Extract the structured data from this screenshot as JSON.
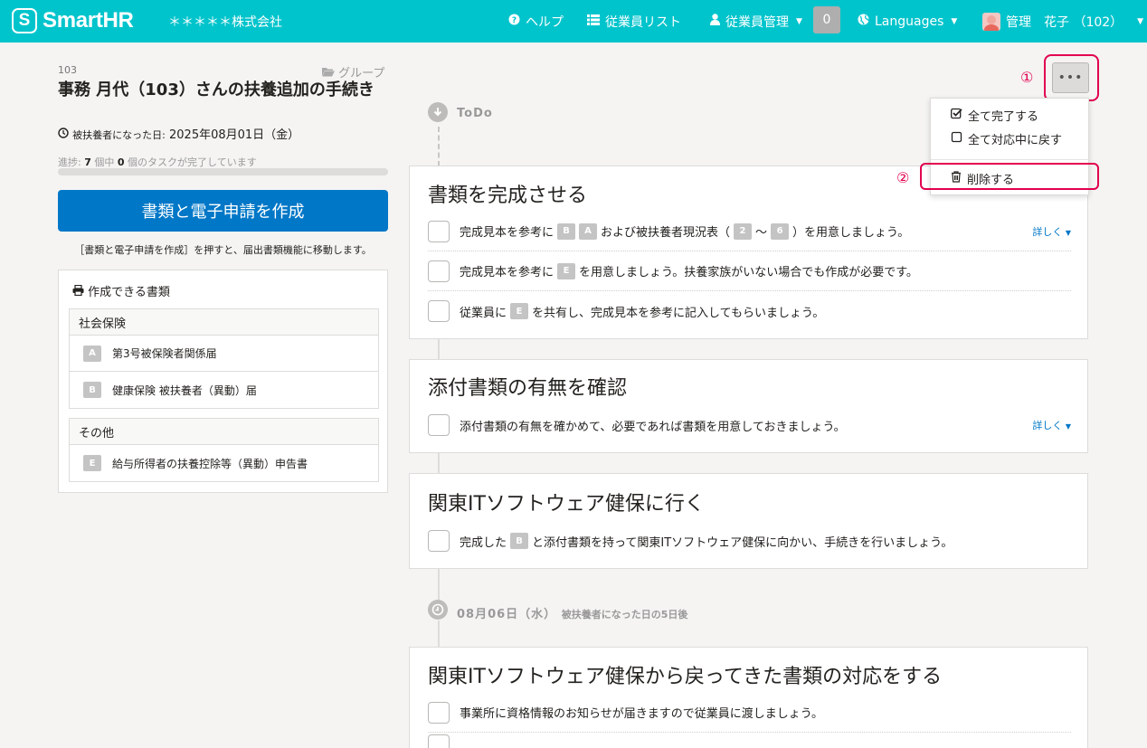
{
  "header": {
    "logo_mark": "S",
    "logo_text": "SmartHR",
    "company": "＊＊＊＊＊株式会社",
    "nav": {
      "help": "ヘルプ",
      "employee_list": "従業員リスト",
      "employee_mgmt": "従業員管理",
      "badge_count": "0",
      "languages": "Languages",
      "user": "管理　花子 （102）"
    }
  },
  "procedure": {
    "number": "103",
    "group_label": "グループ",
    "title": "事務 月代（103）さんの扶養追加の手続き",
    "dep_date_label": "被扶養者になった日:",
    "dep_date_value": "2025年08月01日（金）",
    "progress": {
      "prefix": "進捗:",
      "total": "7",
      "mid": "個中",
      "done": "0",
      "suffix": "個のタスクが完了しています",
      "fraction": 0
    },
    "create_button": "書類と電子申請を作成",
    "create_note": "［書類と電子申請を作成］を押すと、届出書類機能に移動します。"
  },
  "documents": {
    "title": "作成できる書類",
    "groups": [
      {
        "name": "社会保険",
        "items": [
          {
            "badge": "A",
            "label": "第3号被保険者関係届"
          },
          {
            "badge": "B",
            "label": "健康保険 被扶養者（異動）届"
          }
        ]
      },
      {
        "name": "その他",
        "items": [
          {
            "badge": "E",
            "label": "給与所得者の扶養控除等（異動）申告書"
          }
        ]
      }
    ]
  },
  "timeline": {
    "todo_label": "ToDo",
    "date_label": "08月06日（水）",
    "date_sub": "被扶養者になった日の5日後",
    "more_label": "詳しく",
    "cards": [
      {
        "title": "書類を完成させる",
        "tasks": [
          {
            "pre": "完成見本を参考に",
            "b1": "B",
            "b2": "A",
            "mid": "および被扶養者現況表（",
            "b3": "2",
            "tilde": "〜",
            "b4": "6",
            "post": "）を用意しましょう。"
          },
          {
            "pre": "完成見本を参考に",
            "b1": "E",
            "post": "を用意しましょう。扶養家族がいない場合でも作成が必要です。"
          },
          {
            "pre": "従業員に",
            "b1": "E",
            "post": "を共有し、完成見本を参考に記入してもらいましょう。"
          }
        ]
      },
      {
        "title": "添付書類の有無を確認",
        "tasks": [
          {
            "text": "添付書類の有無を確かめて、必要であれば書類を用意しておきましょう。"
          }
        ]
      },
      {
        "title": "関東ITソフトウェア健保に行く",
        "tasks": [
          {
            "pre": "完成した",
            "b1": "B",
            "post": "と添付書類を持って関東ITソフトウェア健保に向かい、手続きを行いましょう。"
          }
        ]
      },
      {
        "title": "関東ITソフトウェア健保から戻ってきた書類の対応をする",
        "tasks": [
          {
            "text": "事業所に資格情報のお知らせが届きますので従業員に渡しましょう。"
          }
        ]
      }
    ]
  },
  "actions_menu": {
    "button_label": "•••",
    "complete_all": "全て完了する",
    "revert_all": "全て対応中に戻す",
    "delete": "削除する"
  },
  "annotations": {
    "one": "①",
    "two": "②",
    "color": "#e2004e"
  },
  "colors": {
    "header": "#00c4cc",
    "primary": "#0077c7"
  }
}
